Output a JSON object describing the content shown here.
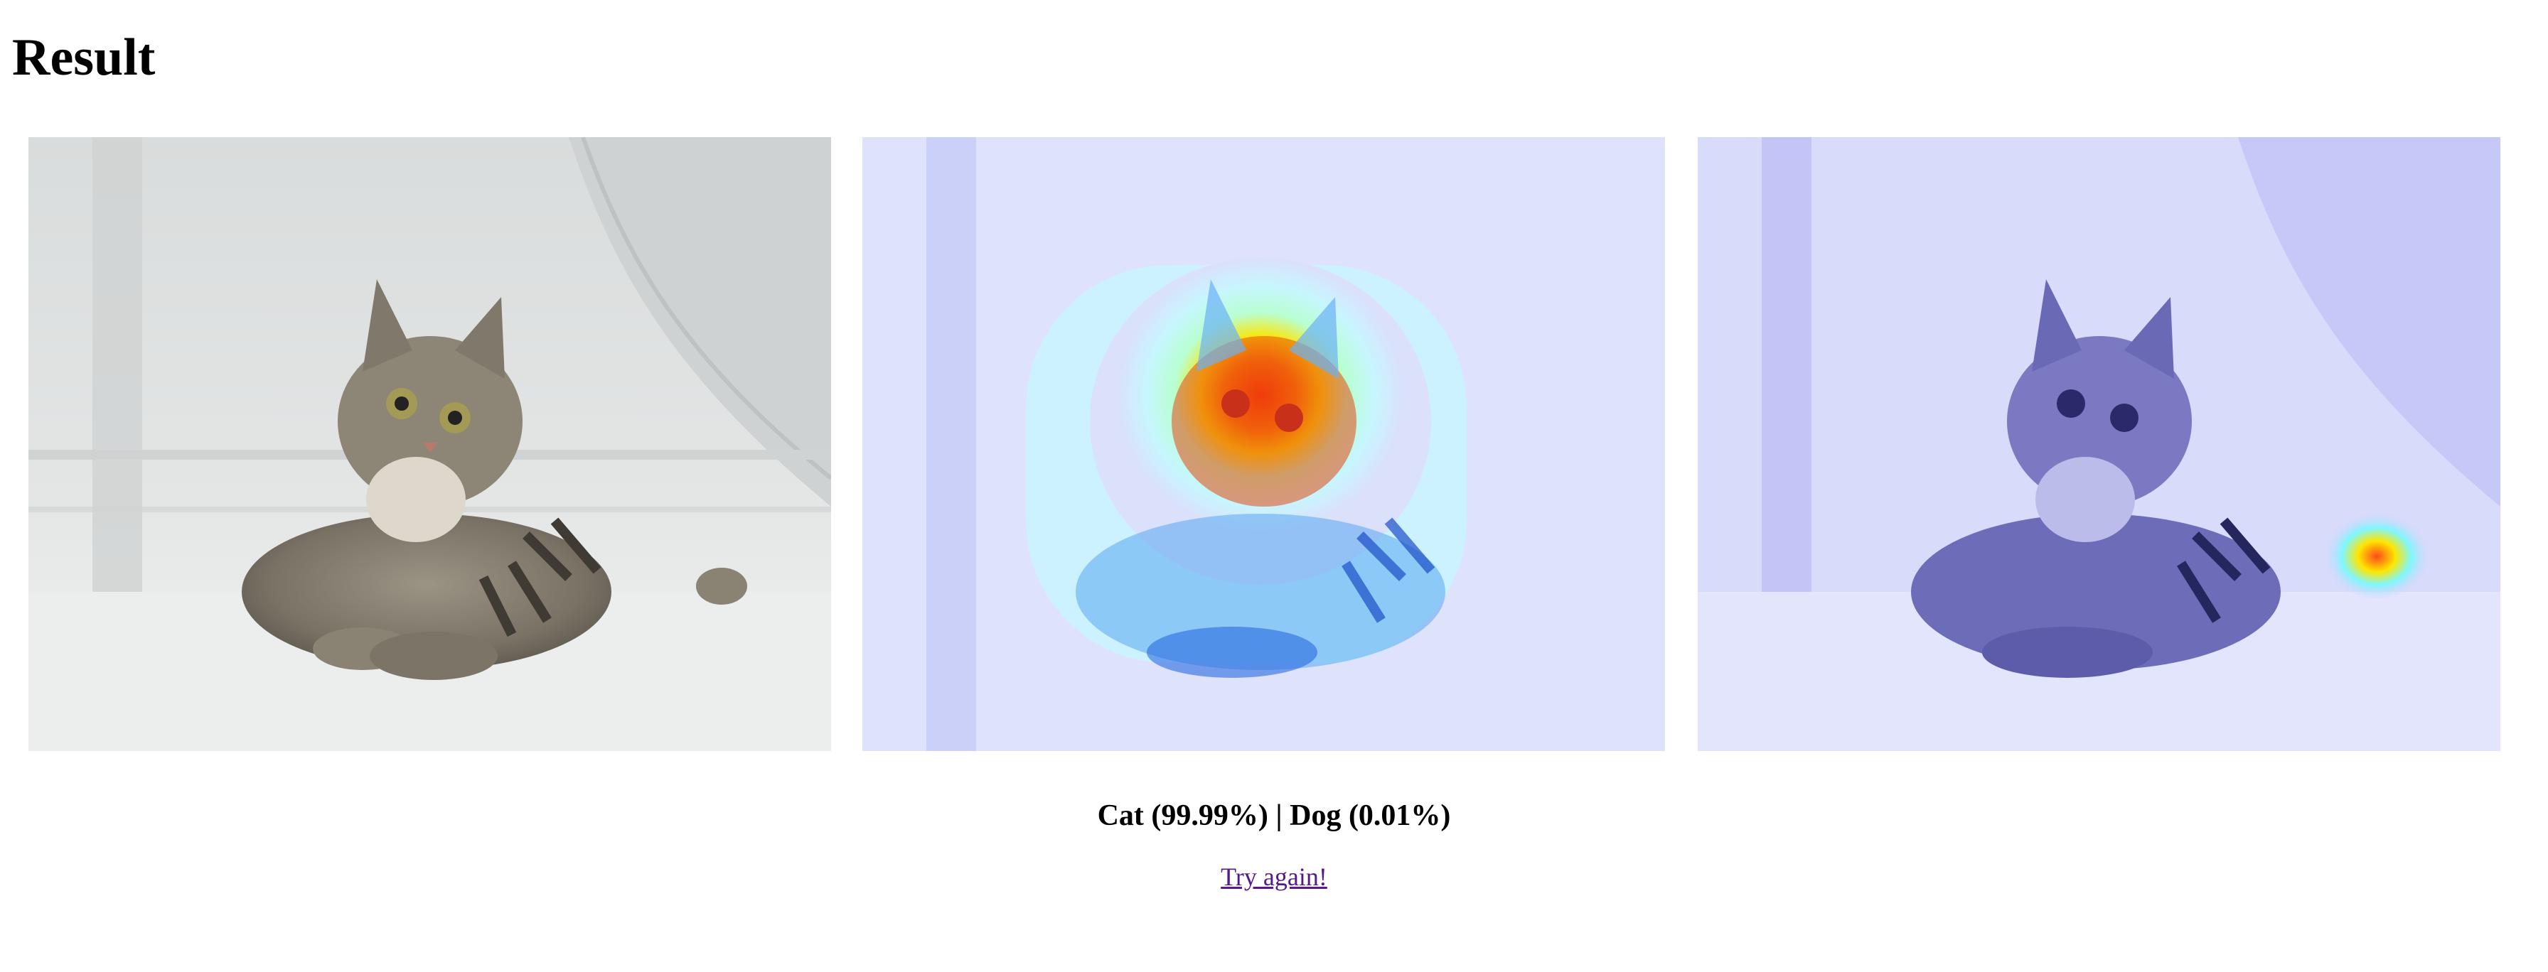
{
  "page": {
    "title": "Result"
  },
  "images": [
    {
      "label": "original-photo",
      "overlay": "none"
    },
    {
      "label": "gradcam-heatmap-cat",
      "overlay": "jet heatmap focused on cat face"
    },
    {
      "label": "gradcam-heatmap-dog",
      "overlay": "blue tint with small hotspot near tail"
    }
  ],
  "prediction": {
    "text": "Cat (99.99%) | Dog (0.01%)"
  },
  "actions": {
    "try_again_label": "Try again!"
  },
  "colors": {
    "link": "#551a8b",
    "background": "#ffffff",
    "floor": "#e9ecec",
    "heat_hot": "#ff2a00",
    "heat_warm": "#ffe600",
    "heat_cool": "#1a8cff"
  }
}
